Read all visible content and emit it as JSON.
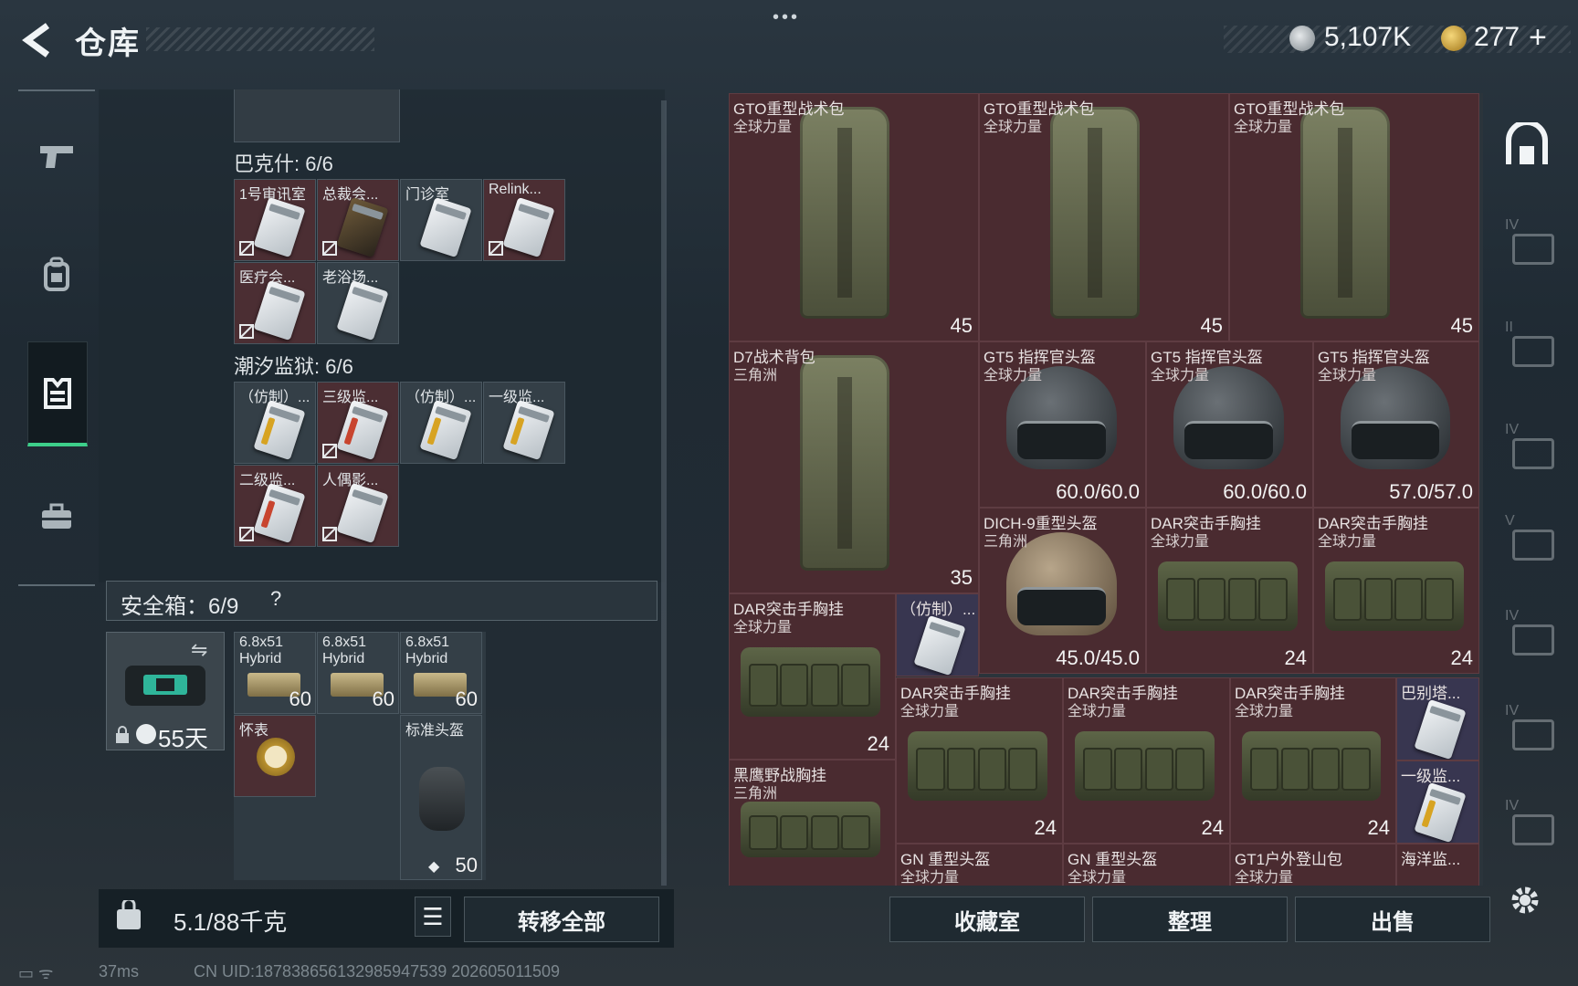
{
  "header": {
    "title": "仓库",
    "menu_dots": "•••",
    "currency": [
      {
        "icon": "silver-coin-icon",
        "value": "5,107K"
      },
      {
        "icon": "gold-coin-icon",
        "value": "277"
      }
    ],
    "plus": "+"
  },
  "sidebar": [
    "pistol-icon",
    "backpack-icon",
    "armor-vest-icon",
    "toolbox-icon"
  ],
  "left_panel": {
    "sections": [
      {
        "label": "巴克什: 6/6",
        "cards": [
          {
            "name": "1号审讯室",
            "card": "white",
            "bound": true
          },
          {
            "name": "总裁会...",
            "card": "dark",
            "bound": true
          },
          {
            "name": "门诊室",
            "card": "white",
            "bound": false
          },
          {
            "name": "Relink...",
            "card": "white",
            "bound": true
          },
          {
            "name": "医疗会...",
            "card": "white",
            "bound": true
          },
          {
            "name": "老浴场...",
            "card": "white",
            "bound": false
          }
        ]
      },
      {
        "label": "潮汐监狱: 6/6",
        "cards": [
          {
            "name": "（仿制）...",
            "card": "white",
            "stripe": "#d7a322",
            "bound": false
          },
          {
            "name": "三级监...",
            "card": "white",
            "stripe": "#c8452f",
            "bound": true
          },
          {
            "name": "（仿制）...",
            "card": "white",
            "stripe": "#d7a322",
            "bound": false
          },
          {
            "name": "一级监...",
            "card": "white",
            "stripe": "#d7a322",
            "bound": false
          },
          {
            "name": "二级监...",
            "card": "white",
            "stripe": "#c8452f",
            "bound": true
          },
          {
            "name": "人偶影...",
            "card": "white",
            "bound": true
          }
        ]
      }
    ],
    "safe": {
      "label": "安全箱：6/9",
      "help": "?",
      "timer": "55天",
      "items": [
        {
          "line1": "6.8x51",
          "line2": "Hybrid",
          "count": "60"
        },
        {
          "line1": "6.8x51",
          "line2": "Hybrid",
          "count": "60"
        },
        {
          "line1": "6.8x51",
          "line2": "Hybrid",
          "count": "60"
        },
        {
          "line1": "怀表",
          "line2": "",
          "count": ""
        },
        {
          "line1": "标准头盔",
          "line2": "",
          "count": "50"
        }
      ]
    },
    "weight": "5.1/88千克",
    "transfer_all": "转移全部"
  },
  "stash": {
    "items": [
      {
        "n1": "GTO重型战术包",
        "n2": "全球力量",
        "val": "45"
      },
      {
        "n1": "GTO重型战术包",
        "n2": "全球力量",
        "val": "45"
      },
      {
        "n1": "GTO重型战术包",
        "n2": "全球力量",
        "val": "45"
      },
      {
        "n1": "D7战术背包",
        "n2": "三角洲",
        "val": "35"
      },
      {
        "n1": "GT5 指挥官头盔",
        "n2": "全球力量",
        "val": "60.0/60.0"
      },
      {
        "n1": "GT5 指挥官头盔",
        "n2": "全球力量",
        "val": "60.0/60.0"
      },
      {
        "n1": "GT5 指挥官头盔",
        "n2": "全球力量",
        "val": "57.0/57.0"
      },
      {
        "n1": "DICH-9重型头盔",
        "n2": "三角洲",
        "val": "45.0/45.0"
      },
      {
        "n1": "DAR突击手胸挂",
        "n2": "全球力量",
        "val": "24"
      },
      {
        "n1": "DAR突击手胸挂",
        "n2": "全球力量",
        "val": "24"
      },
      {
        "n1": "DAR突击手胸挂",
        "n2": "全球力量",
        "val": "24"
      },
      {
        "n1": "（仿制）...",
        "n2": "",
        "val": ""
      },
      {
        "n1": "DAR突击手胸挂",
        "n2": "全球力量",
        "val": "24"
      },
      {
        "n1": "DAR突击手胸挂",
        "n2": "全球力量",
        "val": "24"
      },
      {
        "n1": "DAR突击手胸挂",
        "n2": "全球力量",
        "val": "24"
      },
      {
        "n1": "巴别塔...",
        "n2": "",
        "val": ""
      },
      {
        "n1": "黑鹰野战胸挂",
        "n2": "三角洲",
        "val": ""
      },
      {
        "n1": "一级监...",
        "n2": "",
        "val": ""
      },
      {
        "n1": "GN 重型头盔",
        "n2": "全球力量",
        "val": ""
      },
      {
        "n1": "GN 重型头盔",
        "n2": "全球力量",
        "val": ""
      },
      {
        "n1": "GT1户外登山包",
        "n2": "全球力量",
        "val": ""
      },
      {
        "n1": "海洋监...",
        "n2": "",
        "val": ""
      }
    ],
    "buttons": [
      "收藏室",
      "整理",
      "出售"
    ]
  },
  "right_rail": [
    "storage-home-icon",
    "IV",
    "II",
    "IV",
    "V",
    "IV",
    "IV",
    "IV"
  ],
  "footer": {
    "ping": "37ms",
    "uid": "CN UID:187838656132985947539 202605011509"
  },
  "colors": {
    "accent": "#3dcf8a",
    "item_red": "#4a2b30",
    "panel": "#2b343b"
  }
}
